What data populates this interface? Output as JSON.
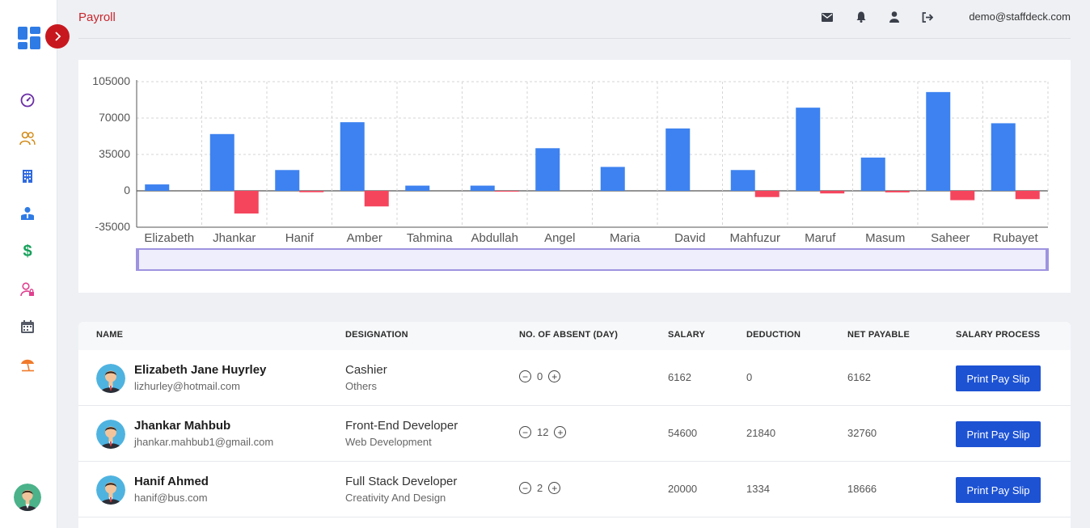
{
  "header": {
    "title": "Payroll",
    "user_email": "demo@staffdeck.com"
  },
  "colors": {
    "accent": "#c8262c",
    "positive_bar": "#3d82f0",
    "negative_bar": "#f5455d",
    "button": "#1d52d3"
  },
  "sidebar": {
    "collapse_icon": "chevron-right-icon",
    "items": [
      {
        "icon": "dashboard-icon",
        "color": "#6b2fa6"
      },
      {
        "icon": "users-icon",
        "color": "#d28a16"
      },
      {
        "icon": "building-icon",
        "color": "#2f6ae0"
      },
      {
        "icon": "employee-icon",
        "color": "#2f7be5"
      },
      {
        "icon": "dollar-icon",
        "color": "#16a05a"
      },
      {
        "icon": "user-lock-icon",
        "color": "#e0408f"
      },
      {
        "icon": "calendar-icon",
        "color": "#555a66"
      },
      {
        "icon": "beach-icon",
        "color": "#f07a2a"
      }
    ]
  },
  "chart_data": {
    "type": "bar",
    "categories": [
      "Elizabeth",
      "Jhankar",
      "Hanif",
      "Amber",
      "Tahmina",
      "Abdullah",
      "Angel",
      "Maria",
      "David",
      "Mahfuzur",
      "Maruf",
      "Masum",
      "Saheer",
      "Rubayet"
    ],
    "series": [
      {
        "values": [
          6162,
          54600,
          20000,
          66000,
          5000,
          5000,
          41000,
          23000,
          60000,
          20000,
          80000,
          32000,
          95000,
          65000
        ]
      },
      {
        "values": [
          0,
          -21840,
          -1334,
          -15000,
          0,
          -500,
          0,
          0,
          0,
          -6000,
          -2500,
          -1500,
          -9000,
          -8000
        ]
      }
    ],
    "y_ticks": [
      "105000",
      "70000",
      "35000",
      "0",
      "-35000"
    ],
    "ylim": [
      -35000,
      105000
    ],
    "grid": true
  },
  "table": {
    "columns": [
      "NAME",
      "DESIGNATION",
      "NO. OF ABSENT (DAY)",
      "SALARY",
      "DEDUCTION",
      "NET PAYABLE",
      "SALARY PROCESS"
    ],
    "rows": [
      {
        "name": "Elizabeth Jane Huyrley",
        "email": "lizhurley@hotmail.com",
        "designation": "Cashier",
        "department": "Others",
        "absent": "0",
        "salary": "6162",
        "deduction": "0",
        "net": "6162",
        "action": "Print Pay Slip"
      },
      {
        "name": "Jhankar Mahbub",
        "email": "jhankar.mahbub1@gmail.com",
        "designation": "Front-End Developer",
        "department": "Web Development",
        "absent": "12",
        "salary": "54600",
        "deduction": "21840",
        "net": "32760",
        "action": "Print Pay Slip"
      },
      {
        "name": "Hanif Ahmed",
        "email": "hanif@bus.com",
        "designation": "Full Stack Developer",
        "department": "Creativity And Design",
        "absent": "2",
        "salary": "20000",
        "deduction": "1334",
        "net": "18666",
        "action": "Print Pay Slip"
      }
    ]
  }
}
